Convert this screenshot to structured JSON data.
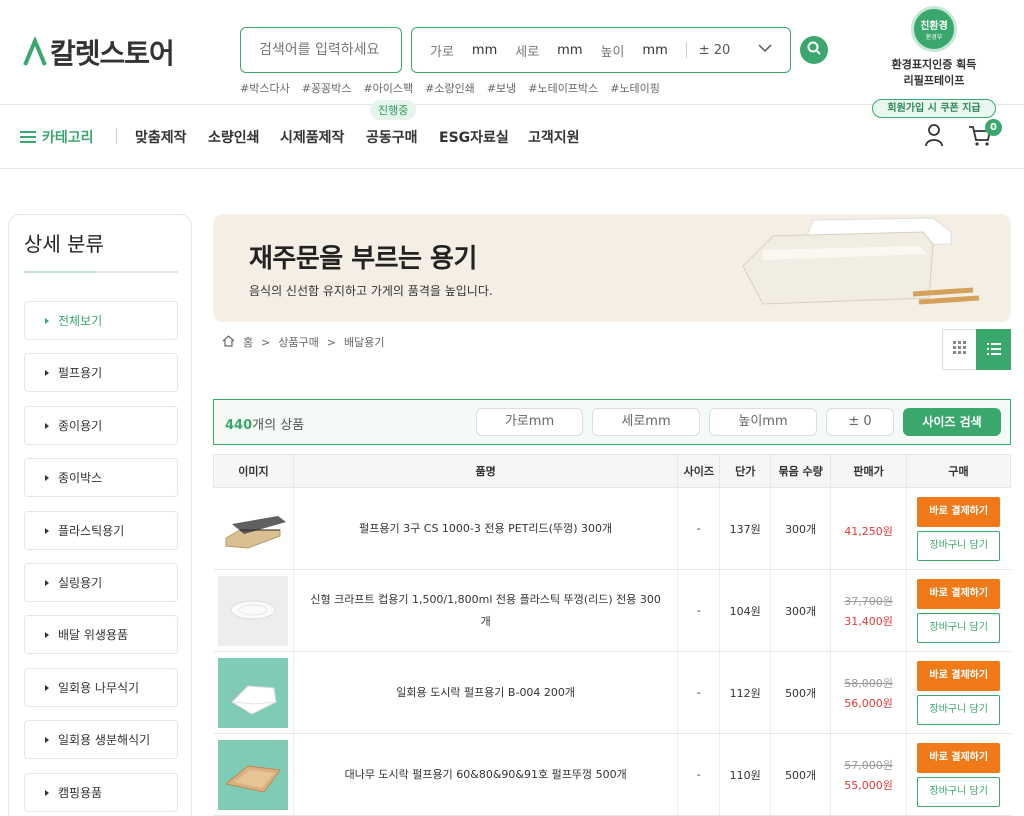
{
  "header": {
    "logo_text": "칼렛스토어",
    "search_placeholder": "검색어를 입력하세요",
    "size_search": {
      "width_label": "가로",
      "width_unit": "mm",
      "depth_label": "세로",
      "depth_unit": "mm",
      "height_label": "높이",
      "height_unit": "mm",
      "tolerance": "± 20"
    },
    "hashtags": [
      "#박스다사",
      "#꽁꽁박스",
      "#아이스팩",
      "#소량인쇄",
      "#보냉",
      "#노테이프박스",
      "#노테이핑"
    ],
    "eco_badge": {
      "line1": "친환경",
      "line2": "환경부",
      "caption1": "환경표지인증 획득",
      "caption2": "리필프테이프"
    }
  },
  "nav": {
    "category_label": "카테고리",
    "items": [
      "맞춤제작",
      "소량인쇄",
      "시제품제작",
      "공동구매",
      "ESG자료실",
      "고객지원"
    ],
    "in_progress_pill": "진행중",
    "coupon_text": "회원가입 시 쿠폰 지급",
    "cart_count": "0"
  },
  "sidebar": {
    "title": "상세 분류",
    "items": [
      "전체보기",
      "펄프용기",
      "종이용기",
      "종이박스",
      "플라스틱용기",
      "실링용기",
      "배달 위생용품",
      "일회용 나무식기",
      "일회용 생분해식기",
      "캠핑용품"
    ]
  },
  "banner": {
    "title": "재주문을 부르는 용기",
    "subtitle": "음식의 신선함 유지하고 가게의 품격을 높입니다."
  },
  "breadcrumb": {
    "home": "홈",
    "level1": "상품구매",
    "level2": "배달용기",
    "sep": ">"
  },
  "filter": {
    "count": "440",
    "count_suffix": "개의 상품",
    "width_placeholder": "가로mm",
    "depth_placeholder": "세로mm",
    "height_placeholder": "높이mm",
    "tolerance": "± 0",
    "search_label": "사이즈 검색"
  },
  "table": {
    "headers": [
      "이미지",
      "품명",
      "사이즈",
      "단가",
      "묶음 수량",
      "판매가",
      "구매"
    ],
    "buy_label": "바로 결제하기",
    "cart_label": "장바구니 담기",
    "rows": [
      {
        "name": "펄프용기 3구 CS 1000-3 전용 PET리드(뚜껑) 300개",
        "size": "-",
        "unit": "137원",
        "qty": "300개",
        "old_price": "",
        "price": "41,250원"
      },
      {
        "name": "신형 크라프트 컵용기 1,500/1,800ml 전용 플라스틱 뚜껑(리드) 전용 300개",
        "size": "-",
        "unit": "104원",
        "qty": "300개",
        "old_price": "37,700원",
        "price": "31,400원"
      },
      {
        "name": "일회용 도시락 펄프용기 B-004 200개",
        "size": "-",
        "unit": "112원",
        "qty": "500개",
        "old_price": "58,000원",
        "price": "56,000원"
      },
      {
        "name": "대나무 도시락 펄프용기 60&80&90&91호 펄프뚜껑 500개",
        "size": "-",
        "unit": "110원",
        "qty": "500개",
        "old_price": "57,000원",
        "price": "55,000원"
      }
    ]
  },
  "colors": {
    "brand_green": "#3aa76d",
    "buy_orange": "#f07a1a",
    "sale_red": "#e03a3a"
  }
}
